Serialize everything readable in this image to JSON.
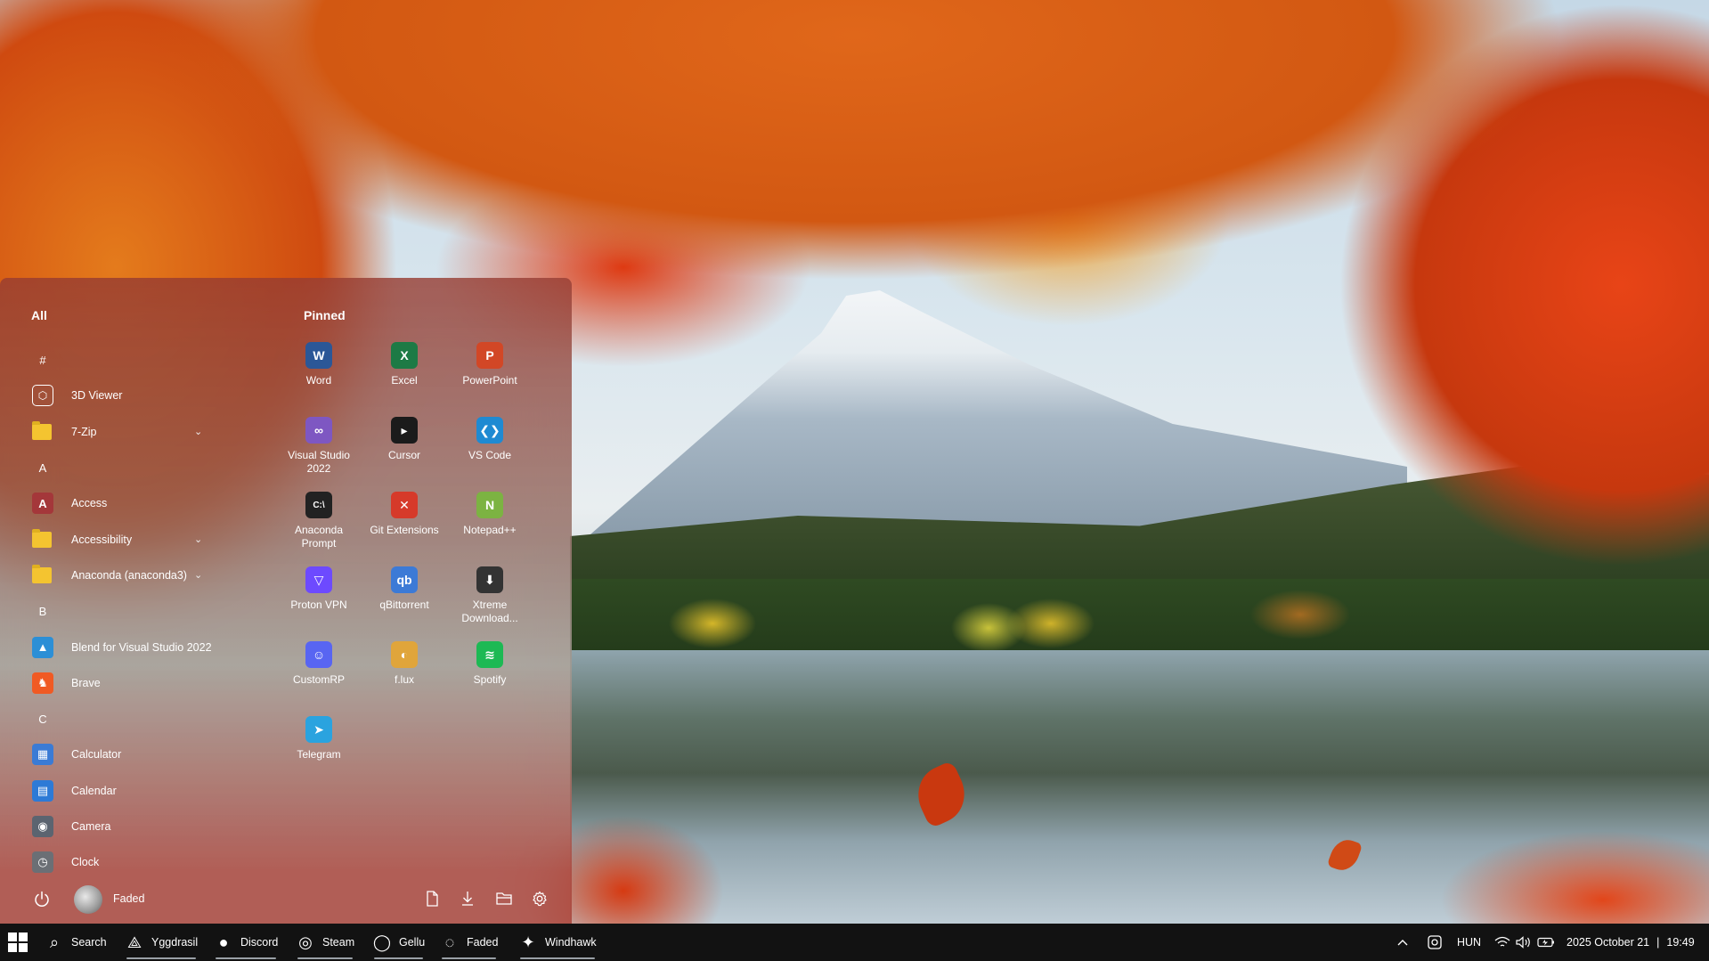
{
  "start_menu": {
    "all_heading": "All",
    "pinned_heading": "Pinned",
    "app_list": [
      {
        "type": "letter",
        "label": "#"
      },
      {
        "type": "app",
        "label": "3D Viewer",
        "icon": "cube-icon"
      },
      {
        "type": "folder",
        "label": "7-Zip",
        "icon": "folder-icon"
      },
      {
        "type": "letter",
        "label": "A"
      },
      {
        "type": "app",
        "label": "Access",
        "icon": "access-icon"
      },
      {
        "type": "folder",
        "label": "Accessibility",
        "icon": "folder-icon"
      },
      {
        "type": "folder",
        "label": "Anaconda (anaconda3)",
        "icon": "folder-icon"
      },
      {
        "type": "letter",
        "label": "B"
      },
      {
        "type": "app",
        "label": "Blend for Visual Studio 2022",
        "icon": "blend-icon"
      },
      {
        "type": "app",
        "label": "Brave",
        "icon": "brave-icon"
      },
      {
        "type": "letter",
        "label": "C"
      },
      {
        "type": "app",
        "label": "Calculator",
        "icon": "calculator-icon"
      },
      {
        "type": "app",
        "label": "Calendar",
        "icon": "calendar-icon"
      },
      {
        "type": "app",
        "label": "Camera",
        "icon": "camera-icon"
      },
      {
        "type": "app",
        "label": "Clock",
        "icon": "clock-icon"
      }
    ],
    "pinned": [
      {
        "label": "Word",
        "icon": "word-icon",
        "color": "#2b5797",
        "glyph": "W"
      },
      {
        "label": "Excel",
        "icon": "excel-icon",
        "color": "#1d7a45",
        "glyph": "X"
      },
      {
        "label": "PowerPoint",
        "icon": "powerpoint-icon",
        "color": "#d24726",
        "glyph": "P"
      },
      {
        "label": "Visual Studio 2022",
        "icon": "visual-studio-icon",
        "color": "#7e57c2",
        "glyph": "∞"
      },
      {
        "label": "Cursor",
        "icon": "cursor-icon",
        "color": "#1b1b1b",
        "glyph": "▸"
      },
      {
        "label": "VS Code",
        "icon": "vscode-icon",
        "color": "#1f8ad2",
        "glyph": "❮❯"
      },
      {
        "label": "Anaconda Prompt",
        "icon": "anaconda-prompt-icon",
        "color": "#222222",
        "glyph": "C:\\"
      },
      {
        "label": "Git Extensions",
        "icon": "git-extensions-icon",
        "color": "#d63a2a",
        "glyph": "✕"
      },
      {
        "label": "Notepad++",
        "icon": "notepad-plus-plus-icon",
        "color": "#7cb342",
        "glyph": "N"
      },
      {
        "label": "Proton VPN",
        "icon": "proton-vpn-icon",
        "color": "#6d4aff",
        "glyph": "▽"
      },
      {
        "label": "qBittorrent",
        "icon": "qbittorrent-icon",
        "color": "#3c7ad6",
        "glyph": "qb"
      },
      {
        "label": "Xtreme Download...",
        "icon": "xtreme-download-icon",
        "color": "#333333",
        "glyph": "⬇"
      },
      {
        "label": "CustomRP",
        "icon": "customrp-icon",
        "color": "#5865f2",
        "glyph": "☺"
      },
      {
        "label": "f.lux",
        "icon": "flux-icon",
        "color": "#e0a53b",
        "glyph": "◐"
      },
      {
        "label": "Spotify",
        "icon": "spotify-icon",
        "color": "#1db954",
        "glyph": "≋"
      },
      {
        "label": "Telegram",
        "icon": "telegram-icon",
        "color": "#2aa3df",
        "glyph": "➤"
      }
    ],
    "user_name": "Faded"
  },
  "taskbar": {
    "items": [
      {
        "label": "Search",
        "icon": "search-icon"
      },
      {
        "label": "Yggdrasil",
        "icon": "yggdrasil-icon"
      },
      {
        "label": "Discord",
        "icon": "discord-icon"
      },
      {
        "label": "Steam",
        "icon": "steam-icon"
      },
      {
        "label": "Gellu",
        "icon": "gellu-icon"
      },
      {
        "label": "Faded",
        "icon": "faded-icon"
      },
      {
        "label": "Windhawk",
        "icon": "windhawk-icon"
      }
    ],
    "language": "HUN",
    "date": "2025 October 21",
    "separator": "|",
    "time": "19:49"
  }
}
